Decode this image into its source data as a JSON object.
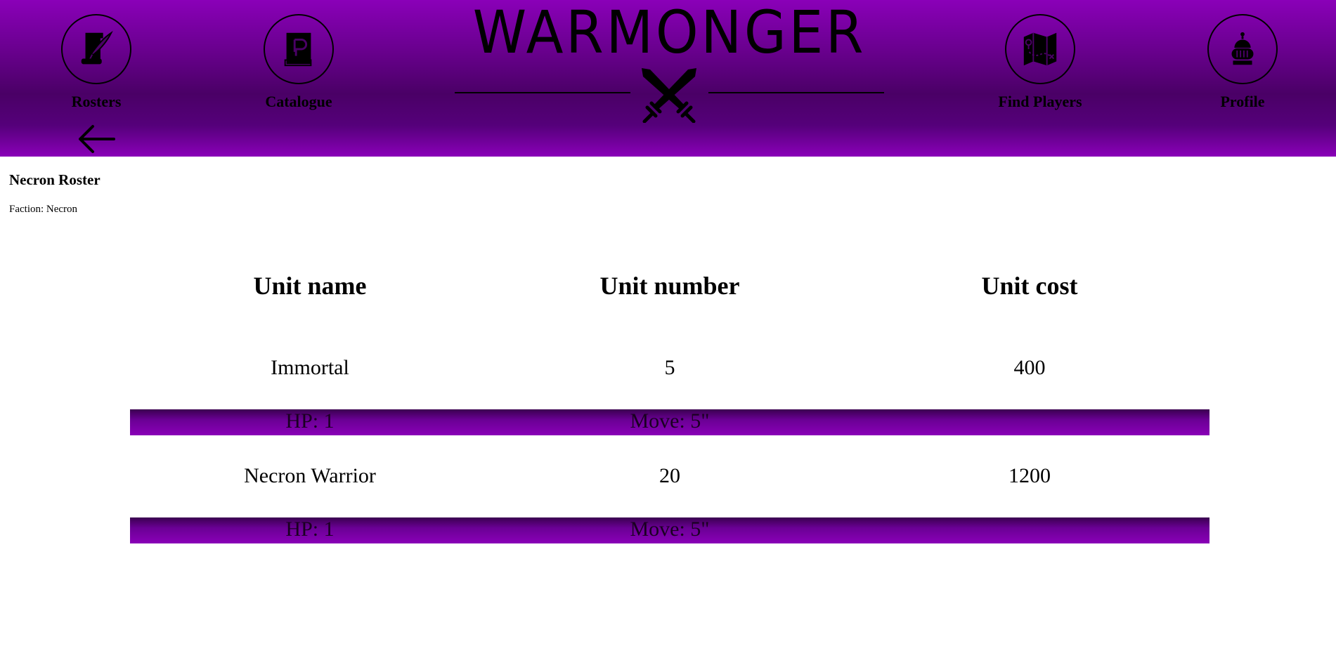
{
  "nav": {
    "rosters": {
      "label": "Rosters",
      "icon": "quill-scroll-icon"
    },
    "catalogue": {
      "label": "Catalogue",
      "icon": "book-icon"
    },
    "find_players": {
      "label": "Find Players",
      "icon": "map-icon"
    },
    "profile": {
      "label": "Profile",
      "icon": "knight-helmet-icon"
    }
  },
  "logo": {
    "text": "WARMONGER",
    "emblem": "crossed-swords-icon"
  },
  "back": {
    "icon": "back-arrow-icon"
  },
  "roster": {
    "title": "Necron Roster",
    "faction": "Faction: Necron"
  },
  "table": {
    "headers": [
      "Unit name",
      "Unit number",
      "Unit cost"
    ],
    "rows": [
      {
        "name": "Immortal",
        "number": "5",
        "cost": "400",
        "hp": "HP: 1",
        "move": "Move: 5\""
      },
      {
        "name": "Necron Warrior",
        "number": "20",
        "cost": "1200",
        "hp": "HP: 1",
        "move": "Move: 5\""
      }
    ]
  },
  "colors": {
    "header_purple": "#8a00b8",
    "header_dark": "#4a0066",
    "detail_bar": "#6a0094"
  }
}
